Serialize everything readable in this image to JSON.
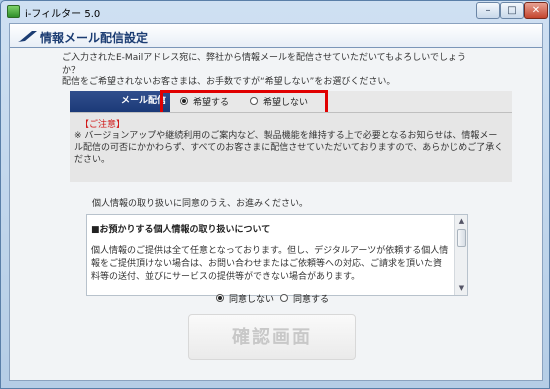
{
  "window": {
    "title": "i-フィルター 5.0"
  },
  "header": {
    "title": "情報メール配信設定"
  },
  "intro": {
    "line1": "ご入力されたE-Mailアドレス宛に、弊社から情報メールを配信させていただいてもよろしいでしょうか？",
    "line2": "配信をご希望されないお客さまは、お手数ですが“希望しない”をお選びください。"
  },
  "mail_delivery": {
    "label": "メール配信",
    "options": [
      "希望する",
      "希望しない"
    ],
    "selected": "希望する"
  },
  "notice": {
    "heading": "【ご注意】",
    "text": "※ バージョンアップや継続利用のご案内など、製品機能を維持する上で必要となるお知らせは、情報メール配信の可否にかかわらず、すべてのお客さまに配信させていただいておりますので、あらかじめご了承ください。"
  },
  "agreement": {
    "intro": "個人情報の取り扱いに同意のうえ、お進みください。",
    "options": [
      "同意しない",
      "同意する"
    ],
    "selected": "同意しない"
  },
  "policy": {
    "title": "■お預かりする個人情報の取り扱いについて",
    "text": "個人情報のご提供は全て任意となっております。但し、デジタルアーツが依頼する個人情報をご提供頂けない場合は、お問い合わせまたはご依頼等への対応、ご請求を頂いた資料等の送付、並びにサービスの提供等ができない場合があります。"
  },
  "buttons": {
    "confirm": "確認画面"
  },
  "window_buttons": {
    "minimize": "–",
    "maximize": "□",
    "close": "✕"
  }
}
